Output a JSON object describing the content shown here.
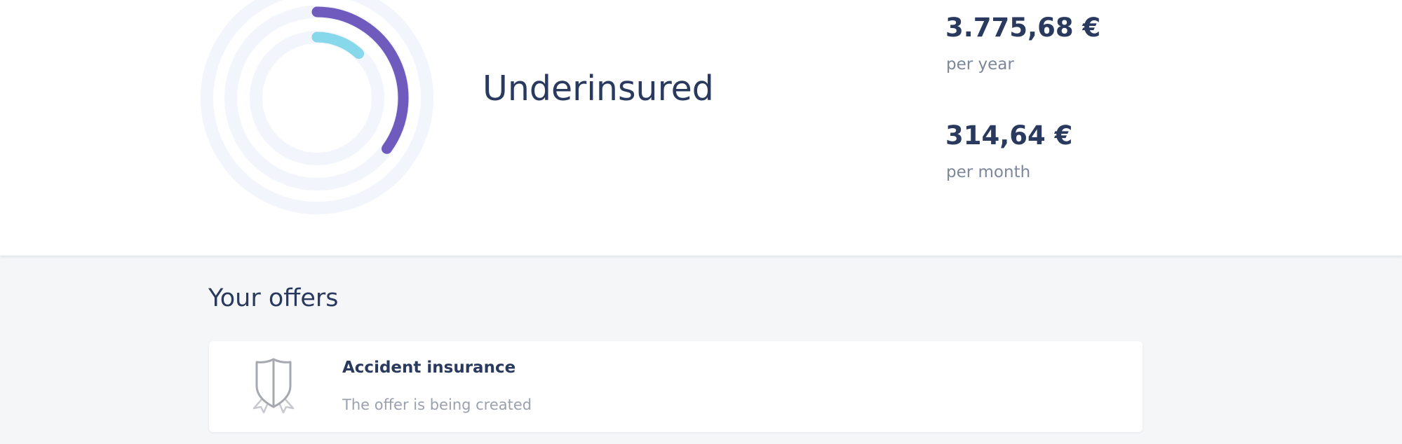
{
  "summary": {
    "status": "Underinsured",
    "gauge": {
      "outer_fill_fraction": 0.35,
      "inner_fill_fraction": 0.12,
      "colors": {
        "track": "#f2f5fc",
        "outer_arc": "#6f5bbd",
        "inner_arc": "#86d8ea"
      }
    },
    "yearly": {
      "value": "3.775,68 €",
      "unit": "per year"
    },
    "monthly": {
      "value": "314,64 €",
      "unit": "per month"
    }
  },
  "offers": {
    "title": "Your offers",
    "items": [
      {
        "icon": "shield-award-icon",
        "name": "Accident insurance",
        "status": "The offer is being created"
      }
    ]
  },
  "colors": {
    "text_primary": "#2a3a5e",
    "text_secondary": "#7d879b",
    "text_muted": "#9aa1ae",
    "page_bg": "#f5f6f8",
    "panel_bg": "#ffffff"
  }
}
